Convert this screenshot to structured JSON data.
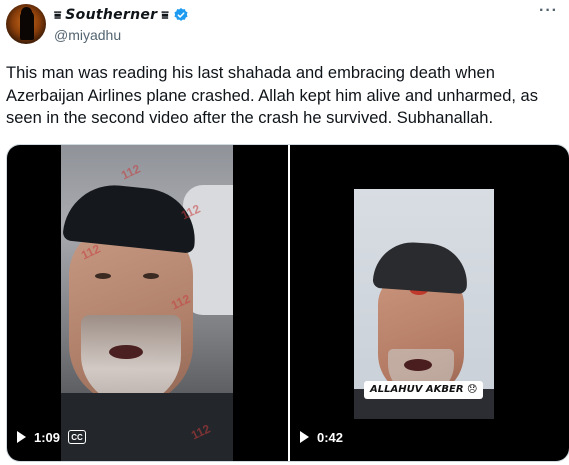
{
  "author": {
    "display_name": "Southerner",
    "name_decoration_left": "⩸",
    "name_decoration_right": "⩸",
    "handle": "@miyadhu",
    "verified_color": "#1d9bf0"
  },
  "tweet": {
    "text": "This man was reading his last shahada and embracing death when Azerbaijan Airlines plane crashed. Allah kept him alive and unharmed, as seen in the second video after the crash he survived. Subhanallah."
  },
  "media": {
    "videos": [
      {
        "duration": "1:09",
        "has_captions": true,
        "captions_label": "CC",
        "watermark": "112"
      },
      {
        "duration": "0:42",
        "has_captions": false,
        "overlay_caption": "ALLAHUV AKBER 😞"
      }
    ]
  },
  "icons": {
    "more": "more-options-icon",
    "verified": "verified-badge-icon",
    "play": "play-icon",
    "captions": "closed-captions-icon"
  }
}
